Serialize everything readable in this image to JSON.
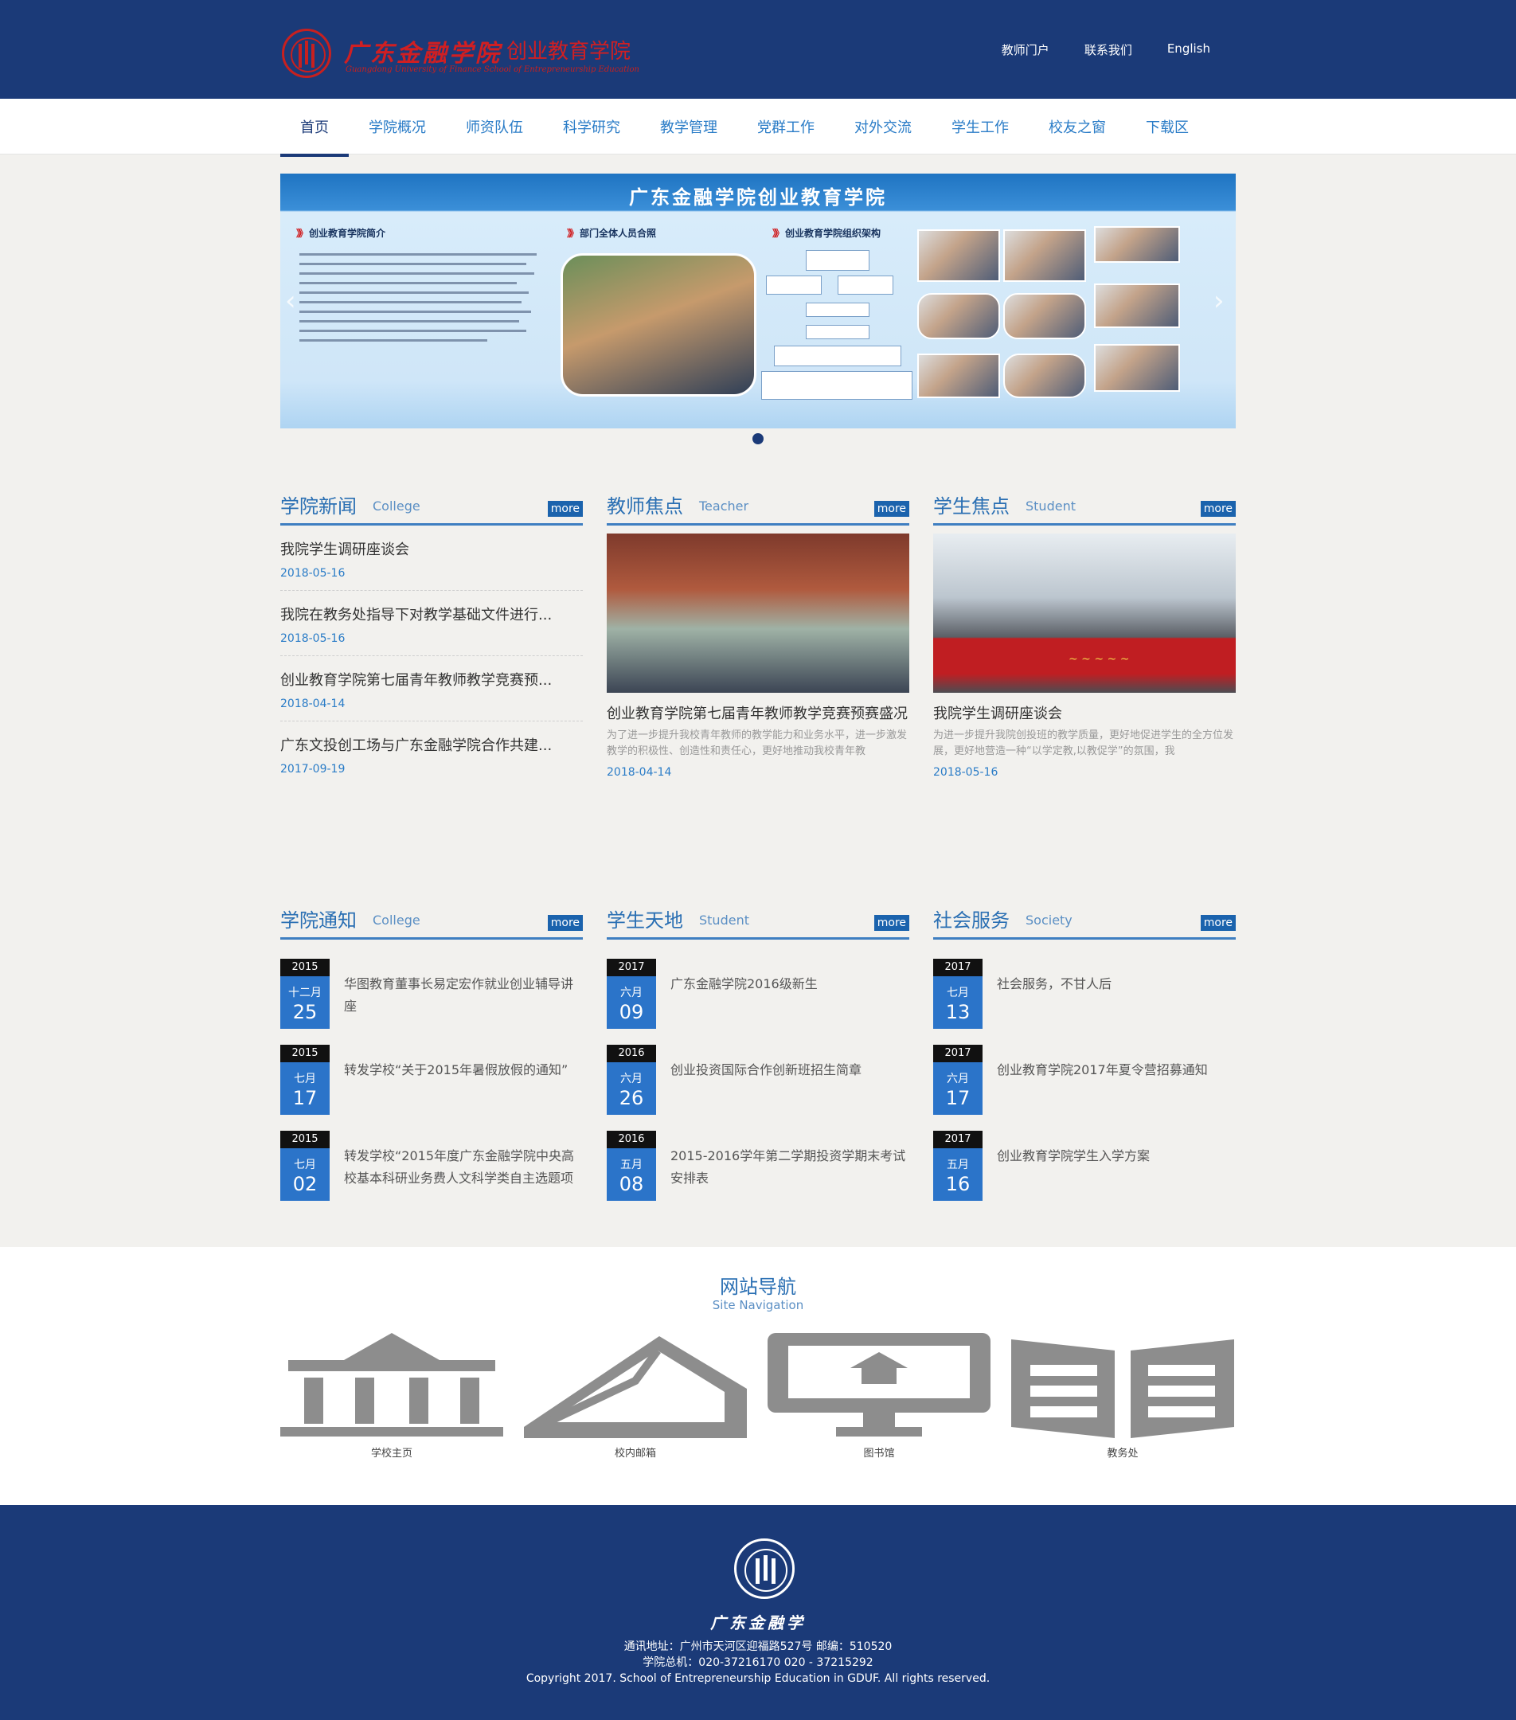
{
  "header": {
    "logo_cn": "广东金融学院",
    "logo_dept": "创业教育学院",
    "logo_en": "Guangdong University of Finance  School of Entrepreneurship Education",
    "links": [
      "教师门户",
      "联系我们",
      "English"
    ]
  },
  "nav": {
    "items": [
      "首页",
      "学院概况",
      "师资队伍",
      "科学研究",
      "教学管理",
      "党群工作",
      "对外交流",
      "学生工作",
      "校友之窗",
      "下载区"
    ],
    "active": "首页"
  },
  "banner": {
    "title": "广东金融学院创业教育学院",
    "panel1": "创业教育学院简介",
    "panel2": "部门全体人员合照",
    "panel3": "创业教育学院组织架构"
  },
  "news": {
    "title": "学院新闻",
    "en": "College",
    "more": "more",
    "items": [
      {
        "title": "我院学生调研座谈会",
        "date": "2018-05-16"
      },
      {
        "title": "我院在教务处指导下对教学基础文件进行...",
        "date": "2018-05-16"
      },
      {
        "title": "创业教育学院第七届青年教师教学竞赛预...",
        "date": "2018-04-14"
      },
      {
        "title": "广东文投创工场与广东金融学院合作共建...",
        "date": "2017-09-19"
      }
    ]
  },
  "teacher": {
    "title": "教师焦点",
    "en": "Teacher",
    "more": "more",
    "item_title": "创业教育学院第七届青年教师教学竞赛预赛盛况",
    "summary": "为了进一步提升我校青年教师的教学能力和业务水平，进一步激发教学的积极性、创造性和责任心，更好地推动我校青年教",
    "date": "2018-04-14"
  },
  "student": {
    "title": "学生焦点",
    "en": "Student",
    "more": "more",
    "item_title": "我院学生调研座谈会",
    "summary": "为进一步提升我院创投班的教学质量，更好地促进学生的全方位发展，更好地营造一种“以学定教,以教促学”的氛围，我",
    "date": "2018-05-16"
  },
  "notices": {
    "title": "学院通知",
    "en": "College",
    "more": "more",
    "items": [
      {
        "year": "2015",
        "month": "十二月",
        "day": "25",
        "title": "华图教育董事长易定宏作就业创业辅导讲座"
      },
      {
        "year": "2015",
        "month": "七月",
        "day": "17",
        "title": "转发学校“关于2015年暑假放假的通知”"
      },
      {
        "year": "2015",
        "month": "七月",
        "day": "02",
        "title": "转发学校“2015年度广东金融学院中央高校基本科研业务费人文科学类自主选题项"
      }
    ]
  },
  "studentworld": {
    "title": "学生天地",
    "en": "Student",
    "more": "more",
    "items": [
      {
        "year": "2017",
        "month": "六月",
        "day": "09",
        "title": "广东金融学院2016级新生"
      },
      {
        "year": "2016",
        "month": "六月",
        "day": "26",
        "title": "创业投资国际合作创新班招生简章"
      },
      {
        "year": "2016",
        "month": "五月",
        "day": "08",
        "title": "2015-2016学年第二学期投资学期末考试安排表"
      }
    ]
  },
  "service": {
    "title": "社会服务",
    "en": "Society",
    "more": "more",
    "items": [
      {
        "year": "2017",
        "month": "七月",
        "day": "13",
        "title": "社会服务，不甘人后"
      },
      {
        "year": "2017",
        "month": "六月",
        "day": "17",
        "title": "创业教育学院2017年夏令营招募通知"
      },
      {
        "year": "2017",
        "month": "五月",
        "day": "16",
        "title": "创业教育学院学生入学方案"
      }
    ]
  },
  "sitenav": {
    "title": "网站导航",
    "en": "Site Navigation",
    "tiles": [
      {
        "label": "学校主页",
        "icon": "school-building-icon"
      },
      {
        "label": "校内邮箱",
        "icon": "mail-envelope-icon"
      },
      {
        "label": "图书馆",
        "icon": "library-monitor-icon"
      },
      {
        "label": "教务处",
        "icon": "open-book-icon"
      }
    ]
  },
  "footer": {
    "name": "广东金融学",
    "address": "通讯地址：广州市天河区迎福路527号  邮编：510520",
    "phone": "学院总机：020-37216170  020 - 37215292",
    "copyright": "Copyright 2017. School of Entrepreneurship Education in GDUF. All rights reserved."
  },
  "colors": {
    "header_bg": "#1b3a78",
    "accent": "#2a7cc7",
    "date_box": "#2b74c9"
  }
}
